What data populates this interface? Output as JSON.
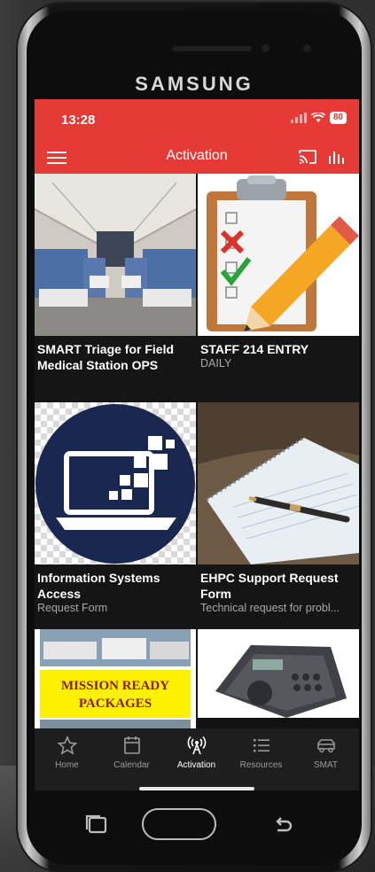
{
  "device": {
    "brand": "SAMSUNG"
  },
  "status_bar": {
    "time": "13:28",
    "battery": "80"
  },
  "app_bar": {
    "title": "Activation"
  },
  "tiles": [
    {
      "title": "SMART Triage for Field Medical Station OPS",
      "subtitle": ""
    },
    {
      "title": "STAFF 214 ENTRY",
      "subtitle": "DAILY"
    },
    {
      "title": "Information Systems Access",
      "subtitle": "Request Form"
    },
    {
      "title": "EHPC Support Request Form",
      "subtitle": "Technical request for probl..."
    },
    {
      "title": "",
      "subtitle": "",
      "image_text": "MISSION READY PACKAGES"
    },
    {
      "title": "",
      "subtitle": ""
    }
  ],
  "nav": [
    {
      "label": "Home",
      "icon": "star-icon"
    },
    {
      "label": "Calendar",
      "icon": "calendar-icon"
    },
    {
      "label": "Activation",
      "icon": "antenna-icon",
      "active": true
    },
    {
      "label": "Resources",
      "icon": "list-icon"
    },
    {
      "label": "SMAT",
      "icon": "truck-icon"
    }
  ],
  "colors": {
    "accent": "#e63a36",
    "background": "#151515"
  }
}
